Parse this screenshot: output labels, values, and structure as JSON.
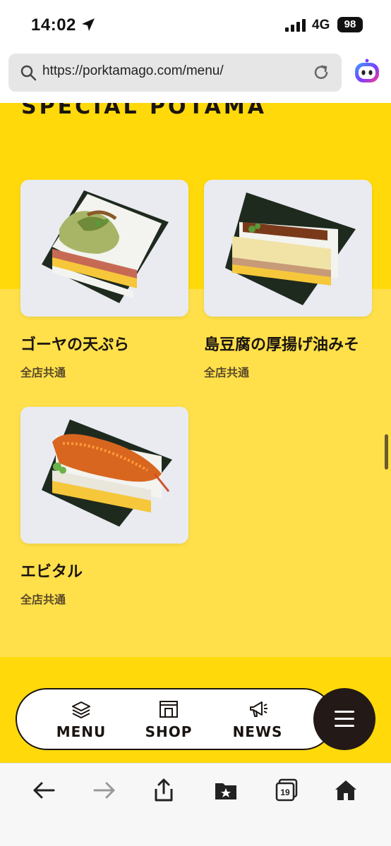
{
  "status_bar": {
    "time": "14:02",
    "network": "4G",
    "battery": "98"
  },
  "browser": {
    "url": "https://porktamago.com/menu/",
    "tabs_count": "19"
  },
  "section": {
    "title": "SPECIAL POTAMA"
  },
  "menu_items": [
    {
      "name": "ゴーヤの天ぷら",
      "availability": "全店共通"
    },
    {
      "name": "島豆腐の厚揚げ油みそ",
      "availability": "全店共通"
    },
    {
      "name": "エビタル",
      "availability": "全店共通"
    }
  ],
  "bottom_nav": {
    "items": [
      {
        "label": "MENU",
        "icon": "menu-stack-icon"
      },
      {
        "label": "SHOP",
        "icon": "shop-icon"
      },
      {
        "label": "NEWS",
        "icon": "megaphone-icon"
      }
    ],
    "hamburger_icon": "hamburger-icon"
  },
  "colors": {
    "accent_yellow": "#ffd90a",
    "light_yellow": "#ffe04a",
    "dark": "#231916"
  }
}
